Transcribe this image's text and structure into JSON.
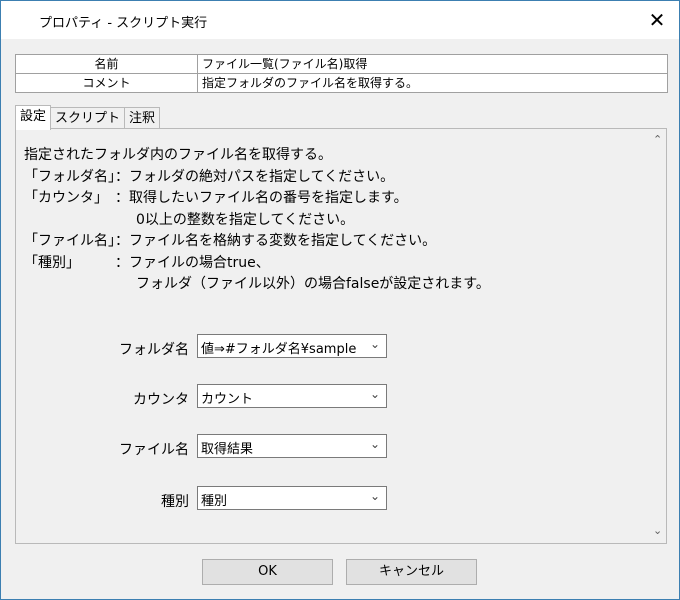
{
  "window": {
    "title": "プロパティ - スクリプト実行",
    "close_glyph": "✕"
  },
  "properties": [
    {
      "key": "名前",
      "value": "ファイル一覧(ファイル名)取得"
    },
    {
      "key": "コメント",
      "value": "指定フォルダのファイル名を取得する。"
    }
  ],
  "tabs": [
    {
      "label": "設定"
    },
    {
      "label": "スクリプト"
    },
    {
      "label": "注釈"
    }
  ],
  "description": [
    "指定されたフォルダ内のファイル名を取得する。",
    "「フォルダ名」：フォルダの絶対パスを指定してください。",
    "「カウンタ」　：取得したいファイル名の番号を指定します。",
    "　　　　　　　　0以上の整数を指定してください。",
    "「ファイル名」：ファイル名を格納する変数を指定してください。",
    "「種別」　　　：ファイルの場合true、",
    "　　　　　　　　フォルダ（ファイル以外）の場合falseが設定されます。"
  ],
  "fields": [
    {
      "label": "フォルダ名",
      "value": "値⇒#フォルダ名¥sample"
    },
    {
      "label": "カウンタ",
      "value": "カウント"
    },
    {
      "label": "ファイル名",
      "value": "取得結果"
    },
    {
      "label": "種別",
      "value": "種別"
    }
  ],
  "buttons": {
    "ok": "OK",
    "cancel": "キャンセル"
  },
  "icons": {
    "scroll_up": "scroll-up-icon",
    "scroll_down": "scroll-down-icon",
    "dropdown": "chevron-down-icon"
  }
}
